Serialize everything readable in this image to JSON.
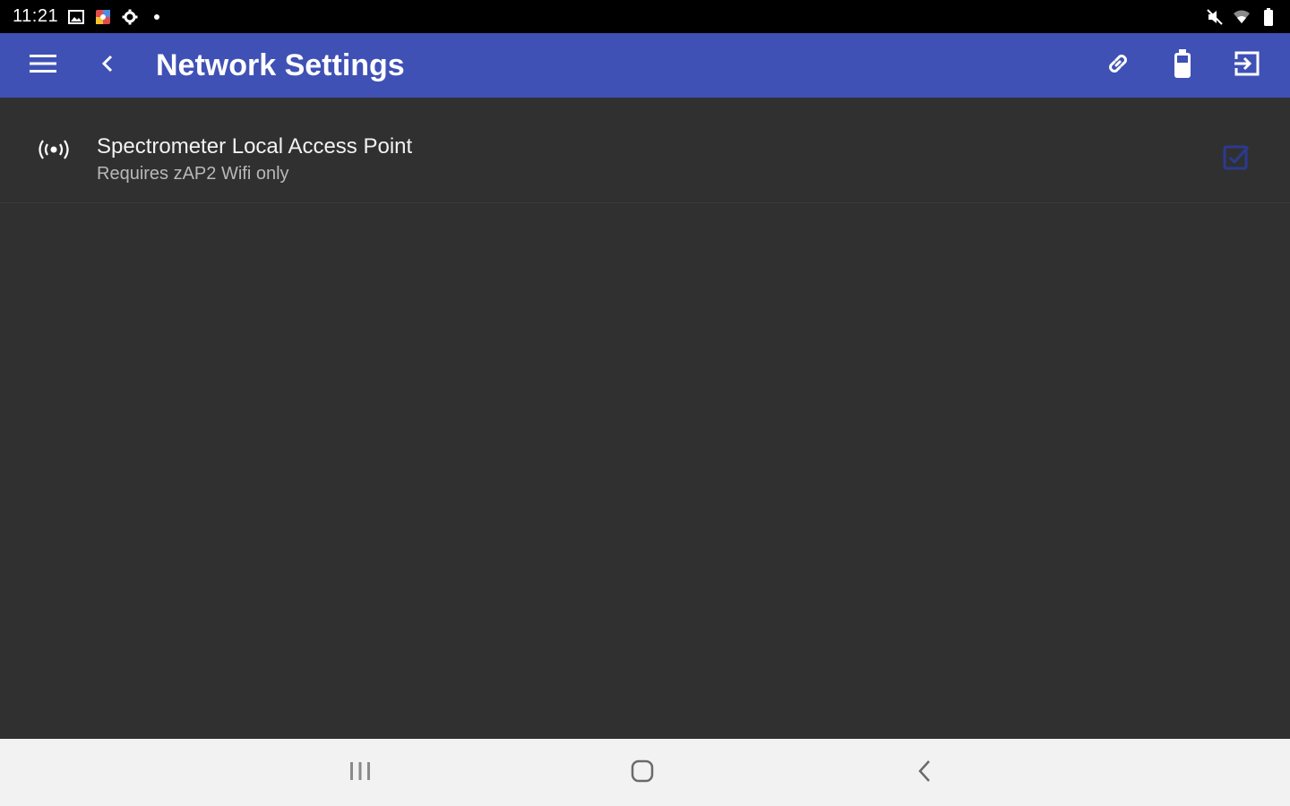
{
  "status_bar": {
    "time": "11:21",
    "notification_icons": [
      "image-icon",
      "photos-icon",
      "settings-gear-icon",
      "dot-icon"
    ],
    "system_icons": [
      "mute-icon",
      "wifi-icon",
      "battery-icon"
    ]
  },
  "app_bar": {
    "title": "Network Settings",
    "background_color": "#3f51b5",
    "leading_icons": [
      "menu-icon",
      "back-arrow-icon"
    ],
    "action_icons": [
      "link-icon",
      "battery-icon",
      "login-icon"
    ]
  },
  "settings": {
    "items": [
      {
        "icon": "access-point-icon",
        "title": "Spectrometer Local Access Point",
        "subtitle": "Requires zAP2 Wifi only",
        "checkbox_checked": true
      }
    ]
  },
  "nav_bar": {
    "icons": [
      "recents-icon",
      "home-icon",
      "back-icon"
    ]
  },
  "colors": {
    "background": "#303030",
    "status_bar": "#000000",
    "checkbox_accent": "#2b3a8f",
    "nav_bar": "#f2f2f2"
  }
}
